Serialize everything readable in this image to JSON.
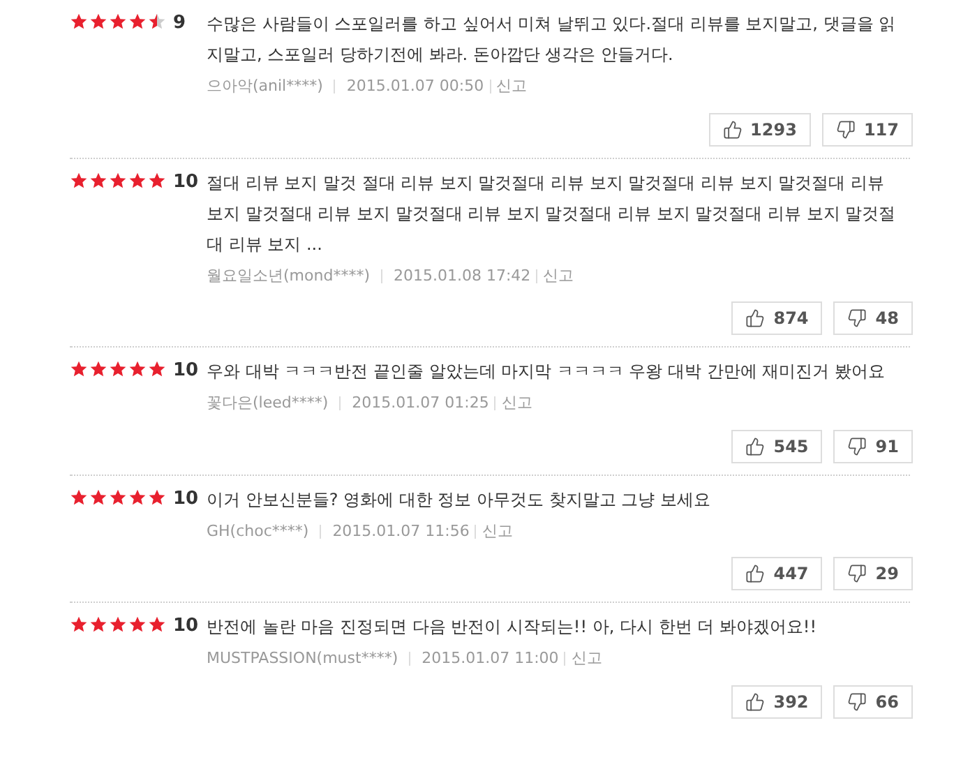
{
  "reviews": [
    {
      "stars": 4.5,
      "score": "9",
      "text": "수많은 사람들이 스포일러를 하고 싶어서 미쳐 날뛰고 있다.절대 리뷰를 보지말고, 댓글을 읽지말고, 스포일러 당하기전에 봐라. 돈아깝단 생각은 안들거다.",
      "author": "으아악(anil****)",
      "date": "2015.01.07 00:50",
      "report": "신고",
      "likes": "1293",
      "dislikes": "117"
    },
    {
      "stars": 5,
      "score": "10",
      "text": "절대 리뷰 보지 말것 절대 리뷰 보지 말것절대 리뷰 보지 말것절대 리뷰 보지 말것절대 리뷰 보지 말것절대 리뷰 보지 말것절대 리뷰 보지 말것절대 리뷰 보지 말것절대 리뷰 보지 말것절대 리뷰 보지 ...",
      "author": "월요일소년(mond****)",
      "date": "2015.01.08 17:42",
      "report": "신고",
      "likes": "874",
      "dislikes": "48"
    },
    {
      "stars": 5,
      "score": "10",
      "text": "우와 대박 ㅋㅋㅋ반전 끝인줄 알았는데 마지막 ㅋㅋㅋㅋ 우왕 대박 간만에 재미진거 봤어요",
      "author": "꽃다은(leed****)",
      "date": "2015.01.07 01:25",
      "report": "신고",
      "likes": "545",
      "dislikes": "91"
    },
    {
      "stars": 5,
      "score": "10",
      "text": "이거 안보신분들? 영화에 대한 정보 아무것도 찾지말고 그냥 보세요",
      "author": "GH(choc****)",
      "date": "2015.01.07 11:56",
      "report": "신고",
      "likes": "447",
      "dislikes": "29"
    },
    {
      "stars": 5,
      "score": "10",
      "text": "반전에 놀란 마음 진정되면 다음 반전이 시작되는!! 아, 다시 한번 더 봐야겠어요!!",
      "author": "MUSTPASSION(must****)",
      "date": "2015.01.07 11:00",
      "report": "신고",
      "likes": "392",
      "dislikes": "66"
    }
  ]
}
